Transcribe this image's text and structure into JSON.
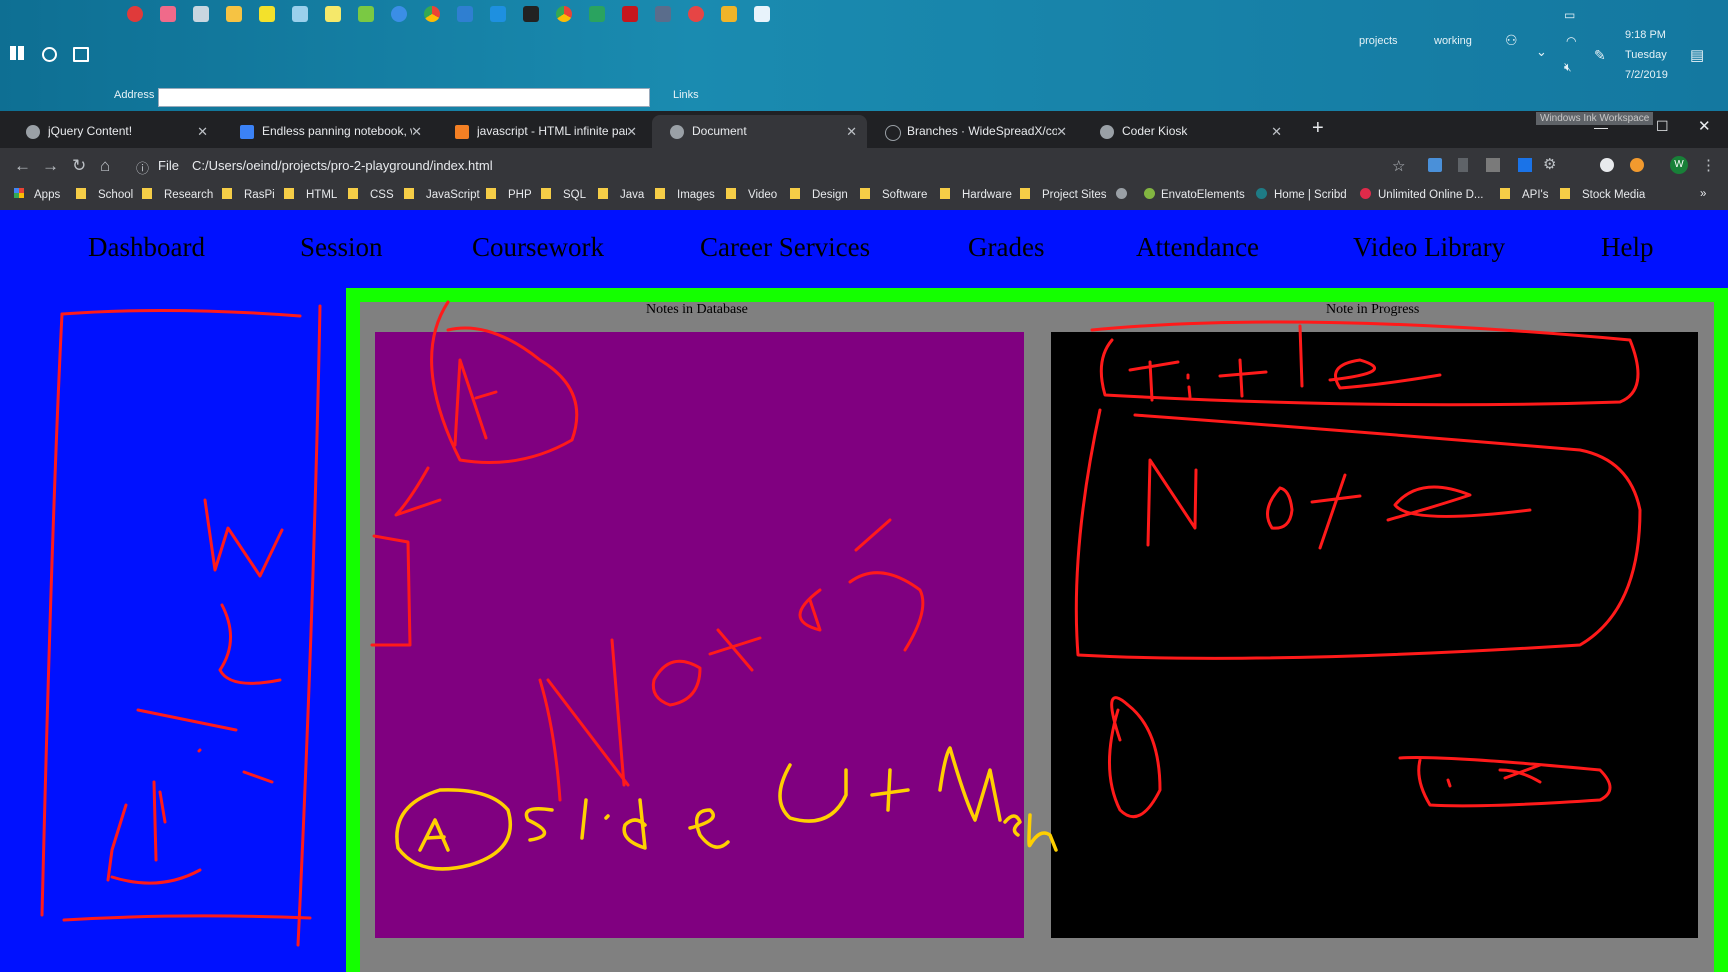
{
  "taskbar": {
    "address_label": "Address",
    "links_label": "Links",
    "toolbars": [
      "projects",
      "working"
    ],
    "clock": {
      "time": "9:18 PM",
      "day": "Tuesday",
      "date": "7/2/2019"
    },
    "tooltip": "Windows Ink Workspace"
  },
  "tabs": [
    {
      "title": "jQuery Content!",
      "icon": "globe-icon"
    },
    {
      "title": "Endless panning notebook, with",
      "icon": "site-icon"
    },
    {
      "title": "javascript - HTML infinite pan-ab",
      "icon": "stackoverflow-icon"
    },
    {
      "title": "Document",
      "icon": "globe-icon",
      "active": true
    },
    {
      "title": "Branches · WideSpreadX/coder_k",
      "icon": "github-icon"
    },
    {
      "title": "Coder Kiosk",
      "icon": "globe-icon"
    }
  ],
  "omnibox": {
    "scheme": "File",
    "url": "C:/Users/oeind/projects/pro-2-playground/index.html"
  },
  "profile_initial": "W",
  "bookmarks": [
    "Apps",
    "School",
    "Research",
    "RasPi",
    "HTML",
    "CSS",
    "JavaScript",
    "PHP",
    "SQL",
    "Java",
    "Images",
    "Video",
    "Design",
    "Software",
    "Hardware",
    "Project Sites",
    "",
    "EnvatoElements",
    "Home | Scribd",
    "Unlimited Online D...",
    "API's",
    "Stock Media"
  ],
  "nav": [
    "Dashboard",
    "Session",
    "Coursework",
    "Career Services",
    "Grades",
    "Attendance",
    "Video Library",
    "Help"
  ],
  "panels": {
    "left_title": "Notes in Database",
    "right_title": "Note in Progress"
  },
  "colors": {
    "page_bg": "#0011ff",
    "frame": "#14ff00",
    "db_canvas": "#800080",
    "np_canvas": "#000000",
    "ink_red": "#ff1a1a",
    "ink_yellow": "#ffd000"
  }
}
